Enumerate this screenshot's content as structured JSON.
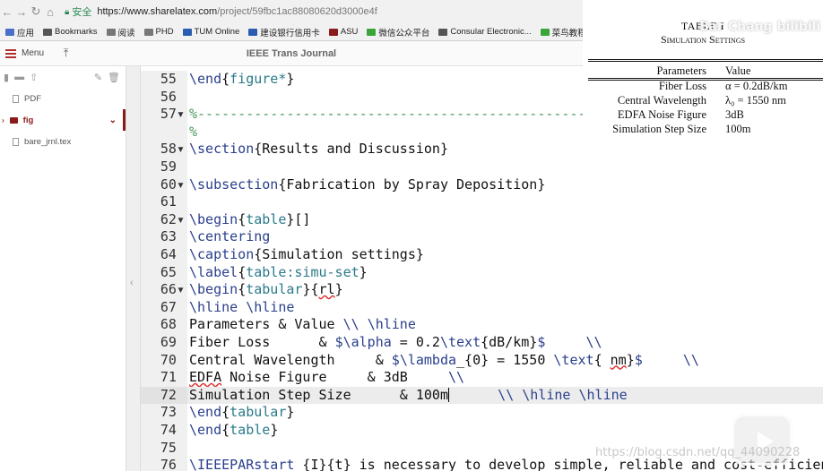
{
  "browser": {
    "secure_label": "安全",
    "url_host": "https://www.sharelatex.com",
    "url_path": "/project/59fbc1ac88080620d3000e4f"
  },
  "bookmarks": [
    {
      "label": "应用",
      "icon": "apps-grid-icon",
      "color": "#4a6fc9"
    },
    {
      "label": "Bookmarks",
      "icon": "star-icon",
      "color": "#555555"
    },
    {
      "label": "阅读",
      "icon": "folder-icon",
      "color": "#777777"
    },
    {
      "label": "PHD",
      "icon": "folder-icon",
      "color": "#777777"
    },
    {
      "label": "TUM Online",
      "icon": "tum-icon",
      "color": "#2a5db0"
    },
    {
      "label": "建设银行信用卡",
      "icon": "bank-icon",
      "color": "#2a5db0"
    },
    {
      "label": "ASU",
      "icon": "asu-icon",
      "color": "#8b1a1a"
    },
    {
      "label": "微信公众平台",
      "icon": "wechat-icon",
      "color": "#3aa63a"
    },
    {
      "label": "Consular Electronic...",
      "icon": "globe-icon",
      "color": "#555555"
    },
    {
      "label": "菜鸟教程",
      "icon": "runoob-icon",
      "color": "#3aa63a"
    }
  ],
  "toolbar": {
    "menu_label": "Menu",
    "project_title": "IEEE Trans Journal"
  },
  "filetree": {
    "items": [
      {
        "label": "PDF",
        "type": "folder-closed"
      },
      {
        "label": "fig",
        "type": "folder-open-selected"
      },
      {
        "label": "bare_jrnl.tex",
        "type": "file"
      }
    ]
  },
  "editor": {
    "lines": [
      {
        "n": "55",
        "text": "\\end{figure*}"
      },
      {
        "n": "56",
        "text": ""
      },
      {
        "n": "57",
        "text": "%------------------------------------------------------"
      },
      {
        "n": "",
        "text": "%"
      },
      {
        "n": "58",
        "text": "\\section{Results and Discussion}"
      },
      {
        "n": "59",
        "text": ""
      },
      {
        "n": "60",
        "text": "\\subsection{Fabrication by Spray Deposition}"
      },
      {
        "n": "61",
        "text": ""
      },
      {
        "n": "62",
        "text": "\\begin{table}[]"
      },
      {
        "n": "63",
        "text": "\\centering"
      },
      {
        "n": "64",
        "text": "\\caption{Simulation settings}"
      },
      {
        "n": "65",
        "text": "\\label{table:simu-set}"
      },
      {
        "n": "66",
        "text": "\\begin{tabular}{rl}"
      },
      {
        "n": "67",
        "text": "\\hline \\hline"
      },
      {
        "n": "68",
        "text": "Parameters & Value \\\\ \\hline"
      },
      {
        "n": "69",
        "text": "Fiber Loss      & $\\alpha = 0.2\\text{dB/km}$     \\\\"
      },
      {
        "n": "70",
        "text": "Central Wavelength     & $\\lambda_{0} = 1550 \\text{ nm}$     \\\\"
      },
      {
        "n": "71",
        "text": "EDFA Noise Figure     & 3dB     \\\\"
      },
      {
        "n": "72",
        "text": "Simulation Step Size      & 100m      \\\\ \\hline \\hline"
      },
      {
        "n": "73",
        "text": "\\end{tabular}"
      },
      {
        "n": "74",
        "text": "\\end{table}"
      },
      {
        "n": "75",
        "text": ""
      },
      {
        "n": "76",
        "text": "\\IEEEPARstart {I}{t} is necessary to develop simple, reliable and cost-efficient"
      }
    ]
  },
  "preview": {
    "table_number": "TABLE I",
    "caption": "Simulation Settings",
    "header": {
      "left": "Parameters",
      "right": "Value"
    },
    "rows": [
      {
        "left": "Fiber Loss",
        "right": "α = 0.2dB/km"
      },
      {
        "left": "Central Wavelength",
        "right": "λ₀ = 1550 nm"
      },
      {
        "left": "EDFA Noise Figure",
        "right": "3dB"
      },
      {
        "left": "Simulation Step Size",
        "right": "100m"
      }
    ]
  },
  "watermarks": {
    "top": "Bar Chang bilibili",
    "bottom": "https://blog.csdn.net/qq_44090228"
  }
}
